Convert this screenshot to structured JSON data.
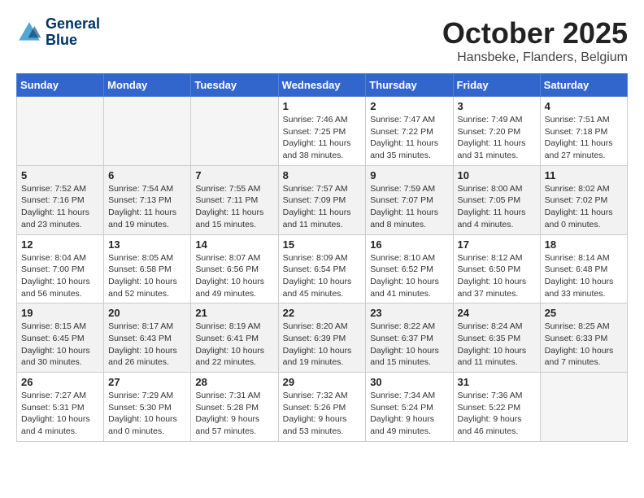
{
  "header": {
    "logo_line1": "General",
    "logo_line2": "Blue",
    "month_title": "October 2025",
    "location": "Hansbeke, Flanders, Belgium"
  },
  "days_of_week": [
    "Sunday",
    "Monday",
    "Tuesday",
    "Wednesday",
    "Thursday",
    "Friday",
    "Saturday"
  ],
  "weeks": [
    [
      {
        "day": "",
        "info": ""
      },
      {
        "day": "",
        "info": ""
      },
      {
        "day": "",
        "info": ""
      },
      {
        "day": "1",
        "info": "Sunrise: 7:46 AM\nSunset: 7:25 PM\nDaylight: 11 hours\nand 38 minutes."
      },
      {
        "day": "2",
        "info": "Sunrise: 7:47 AM\nSunset: 7:22 PM\nDaylight: 11 hours\nand 35 minutes."
      },
      {
        "day": "3",
        "info": "Sunrise: 7:49 AM\nSunset: 7:20 PM\nDaylight: 11 hours\nand 31 minutes."
      },
      {
        "day": "4",
        "info": "Sunrise: 7:51 AM\nSunset: 7:18 PM\nDaylight: 11 hours\nand 27 minutes."
      }
    ],
    [
      {
        "day": "5",
        "info": "Sunrise: 7:52 AM\nSunset: 7:16 PM\nDaylight: 11 hours\nand 23 minutes."
      },
      {
        "day": "6",
        "info": "Sunrise: 7:54 AM\nSunset: 7:13 PM\nDaylight: 11 hours\nand 19 minutes."
      },
      {
        "day": "7",
        "info": "Sunrise: 7:55 AM\nSunset: 7:11 PM\nDaylight: 11 hours\nand 15 minutes."
      },
      {
        "day": "8",
        "info": "Sunrise: 7:57 AM\nSunset: 7:09 PM\nDaylight: 11 hours\nand 11 minutes."
      },
      {
        "day": "9",
        "info": "Sunrise: 7:59 AM\nSunset: 7:07 PM\nDaylight: 11 hours\nand 8 minutes."
      },
      {
        "day": "10",
        "info": "Sunrise: 8:00 AM\nSunset: 7:05 PM\nDaylight: 11 hours\nand 4 minutes."
      },
      {
        "day": "11",
        "info": "Sunrise: 8:02 AM\nSunset: 7:02 PM\nDaylight: 11 hours\nand 0 minutes."
      }
    ],
    [
      {
        "day": "12",
        "info": "Sunrise: 8:04 AM\nSunset: 7:00 PM\nDaylight: 10 hours\nand 56 minutes."
      },
      {
        "day": "13",
        "info": "Sunrise: 8:05 AM\nSunset: 6:58 PM\nDaylight: 10 hours\nand 52 minutes."
      },
      {
        "day": "14",
        "info": "Sunrise: 8:07 AM\nSunset: 6:56 PM\nDaylight: 10 hours\nand 49 minutes."
      },
      {
        "day": "15",
        "info": "Sunrise: 8:09 AM\nSunset: 6:54 PM\nDaylight: 10 hours\nand 45 minutes."
      },
      {
        "day": "16",
        "info": "Sunrise: 8:10 AM\nSunset: 6:52 PM\nDaylight: 10 hours\nand 41 minutes."
      },
      {
        "day": "17",
        "info": "Sunrise: 8:12 AM\nSunset: 6:50 PM\nDaylight: 10 hours\nand 37 minutes."
      },
      {
        "day": "18",
        "info": "Sunrise: 8:14 AM\nSunset: 6:48 PM\nDaylight: 10 hours\nand 33 minutes."
      }
    ],
    [
      {
        "day": "19",
        "info": "Sunrise: 8:15 AM\nSunset: 6:45 PM\nDaylight: 10 hours\nand 30 minutes."
      },
      {
        "day": "20",
        "info": "Sunrise: 8:17 AM\nSunset: 6:43 PM\nDaylight: 10 hours\nand 26 minutes."
      },
      {
        "day": "21",
        "info": "Sunrise: 8:19 AM\nSunset: 6:41 PM\nDaylight: 10 hours\nand 22 minutes."
      },
      {
        "day": "22",
        "info": "Sunrise: 8:20 AM\nSunset: 6:39 PM\nDaylight: 10 hours\nand 19 minutes."
      },
      {
        "day": "23",
        "info": "Sunrise: 8:22 AM\nSunset: 6:37 PM\nDaylight: 10 hours\nand 15 minutes."
      },
      {
        "day": "24",
        "info": "Sunrise: 8:24 AM\nSunset: 6:35 PM\nDaylight: 10 hours\nand 11 minutes."
      },
      {
        "day": "25",
        "info": "Sunrise: 8:25 AM\nSunset: 6:33 PM\nDaylight: 10 hours\nand 7 minutes."
      }
    ],
    [
      {
        "day": "26",
        "info": "Sunrise: 7:27 AM\nSunset: 5:31 PM\nDaylight: 10 hours\nand 4 minutes."
      },
      {
        "day": "27",
        "info": "Sunrise: 7:29 AM\nSunset: 5:30 PM\nDaylight: 10 hours\nand 0 minutes."
      },
      {
        "day": "28",
        "info": "Sunrise: 7:31 AM\nSunset: 5:28 PM\nDaylight: 9 hours\nand 57 minutes."
      },
      {
        "day": "29",
        "info": "Sunrise: 7:32 AM\nSunset: 5:26 PM\nDaylight: 9 hours\nand 53 minutes."
      },
      {
        "day": "30",
        "info": "Sunrise: 7:34 AM\nSunset: 5:24 PM\nDaylight: 9 hours\nand 49 minutes."
      },
      {
        "day": "31",
        "info": "Sunrise: 7:36 AM\nSunset: 5:22 PM\nDaylight: 9 hours\nand 46 minutes."
      },
      {
        "day": "",
        "info": ""
      }
    ]
  ]
}
